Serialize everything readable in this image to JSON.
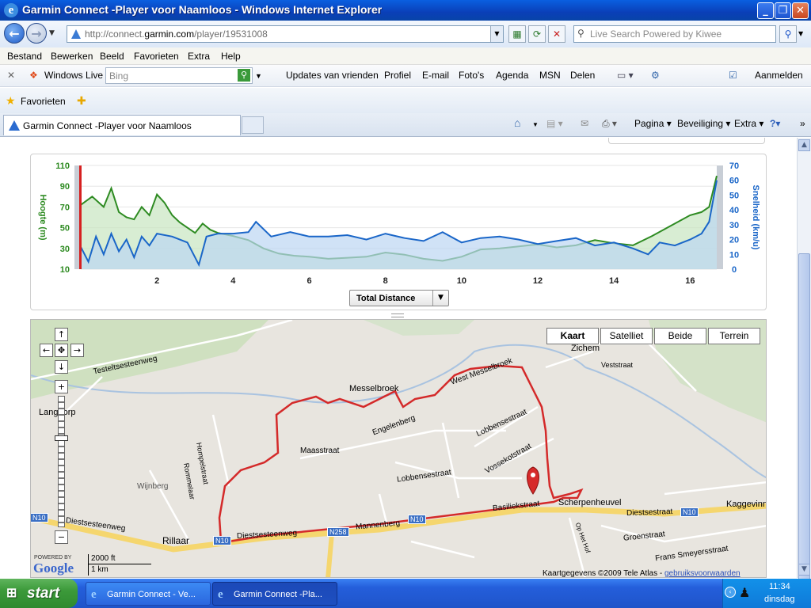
{
  "window": {
    "title": "Garmin Connect -Player voor Naamloos - Windows Internet Explorer",
    "buttons": {
      "minimize": "_",
      "maximize": "❐",
      "close": "✕"
    }
  },
  "address_bar": {
    "url_prefix": "http://connect.",
    "url_domain": "garmin.com",
    "url_suffix": "/player/19531008",
    "search_placeholder": "Live Search Powered by Kiwee"
  },
  "menu": [
    "Bestand",
    "Bewerken",
    "Beeld",
    "Favorieten",
    "Extra",
    "Help"
  ],
  "live_toolbar": {
    "brand": "Windows Live",
    "search_placeholder": "Bing",
    "links": [
      "Updates van vrienden",
      "Profiel",
      "E-mail",
      "Foto's",
      "Agenda",
      "MSN",
      "Delen"
    ],
    "signin": "Aanmelden"
  },
  "favorites_bar": {
    "label": "Favorieten"
  },
  "tabs": {
    "active_label": "Garmin Connect -Player voor Naamloos",
    "commands": [
      "Pagina",
      "Beveiliging",
      "Extra"
    ]
  },
  "chart": {
    "dropdown_label": "Total Distance",
    "left_axis_label": "Hoogte (m)",
    "right_axis_label": "Snelheid (km/u)",
    "colors": {
      "elevation": "#2e8b22",
      "elevation_fill": "#c7e6c0",
      "speed": "#1a66c8",
      "speed_fill": "#bcd6f2",
      "marker_start": "#d62020"
    }
  },
  "chart_data": {
    "type": "area",
    "x_ticks": [
      2,
      4,
      6,
      8,
      10,
      12,
      14,
      16
    ],
    "xlim": [
      0,
      16.7
    ],
    "left_ticks": [
      10,
      30,
      50,
      70,
      90,
      110
    ],
    "ylim_left": [
      10,
      110
    ],
    "right_ticks": [
      0,
      10,
      20,
      30,
      40,
      50,
      60,
      70
    ],
    "ylim_right": [
      0,
      70
    ],
    "series": [
      {
        "name": "Hoogte (m)",
        "axis": "left",
        "x": [
          0,
          0.3,
          0.6,
          0.8,
          1.0,
          1.2,
          1.4,
          1.6,
          1.8,
          2.0,
          2.2,
          2.4,
          2.6,
          2.8,
          3.0,
          3.2,
          3.4,
          3.6,
          4.0,
          4.4,
          4.8,
          5.2,
          5.6,
          6.0,
          6.5,
          7.0,
          7.5,
          8.0,
          8.5,
          9.0,
          9.5,
          10.0,
          10.5,
          11.0,
          11.5,
          12.0,
          12.5,
          13.0,
          13.5,
          14.0,
          14.5,
          15.0,
          15.5,
          16.0,
          16.3,
          16.5,
          16.7
        ],
        "y": [
          72,
          80,
          70,
          88,
          65,
          60,
          58,
          70,
          62,
          82,
          74,
          62,
          55,
          50,
          45,
          54,
          48,
          45,
          42,
          38,
          30,
          25,
          23,
          22,
          20,
          21,
          22,
          26,
          24,
          20,
          18,
          22,
          29,
          30,
          32,
          34,
          31,
          33,
          38,
          35,
          33,
          42,
          52,
          62,
          65,
          70,
          100
        ]
      },
      {
        "name": "Snelheid (km/u)",
        "axis": "right",
        "x": [
          0,
          0.2,
          0.4,
          0.6,
          0.8,
          1.0,
          1.2,
          1.4,
          1.6,
          1.8,
          2.0,
          2.4,
          2.8,
          3.1,
          3.3,
          3.6,
          4.0,
          4.4,
          4.6,
          5.0,
          5.5,
          6.0,
          6.5,
          7.0,
          7.5,
          8.0,
          8.5,
          9.0,
          9.5,
          10.0,
          10.5,
          11.0,
          11.5,
          12.0,
          12.5,
          13.0,
          13.5,
          14.0,
          14.5,
          14.9,
          15.2,
          15.6,
          16.0,
          16.3,
          16.5,
          16.7
        ],
        "y": [
          15,
          5,
          22,
          10,
          24,
          12,
          20,
          8,
          22,
          16,
          24,
          22,
          18,
          3,
          22,
          24,
          24,
          25,
          32,
          22,
          25,
          22,
          22,
          23,
          20,
          24,
          21,
          19,
          25,
          18,
          21,
          22,
          20,
          17,
          19,
          21,
          16,
          18,
          14,
          10,
          18,
          16,
          20,
          24,
          32,
          60
        ]
      }
    ]
  },
  "map": {
    "types": [
      "Kaart",
      "Satelliet",
      "Beide",
      "Terrein"
    ],
    "selected_type": "Kaart",
    "labels": {
      "zichem": "Zichem",
      "messelbroek": "Messelbroek",
      "langdorp": "Langdorp",
      "wijnberg": "Wijnberg",
      "rillaar": "Rillaar",
      "scherpenheuvel": "Scherpenheuvel",
      "kaggevinne": "Kaggevinn",
      "diestsesteenweg": "Diestsesteenweg",
      "diestsestraat": "Diestsestraat",
      "basiliekstraat": "Basiliekstraat",
      "mannenberg": "Mannenberg",
      "n10a": "N10",
      "n10b": "N10",
      "n10c": "N10",
      "n258": "N258",
      "testeltsesteenweg": "Testeltsesteenweg",
      "maasstraat": "Maasstraat",
      "engelenberg": "Engelenberg",
      "lobbensestraat": "Lobbensestraat",
      "vossekotstraat": "Vossekotstraat",
      "veststraat": "Veststraat",
      "groenstraat": "Groenstraat",
      "frans": "Frans Smeyersstraat",
      "westmesselbroek": "West Messelbroek",
      "hompelstraat": "Hompelstraat",
      "rommelaar": "Rommelaar",
      "n10d": "N10",
      "ophethof": "Op Het Hof"
    },
    "scale": {
      "ft": "2000 ft",
      "km": "1 km"
    },
    "powered_by": "POWERED BY",
    "google": "Google",
    "attribution": "Kaartgegevens ©2009 Tele Atlas -",
    "terms_link": "gebruiksvoorwaarden",
    "route_color": "#d42a2a"
  },
  "taskbar": {
    "start": "start",
    "items": [
      "Garmin Connect - Ve...",
      "Garmin Connect -Pla..."
    ],
    "time": "11:34",
    "day": "dinsdag"
  }
}
